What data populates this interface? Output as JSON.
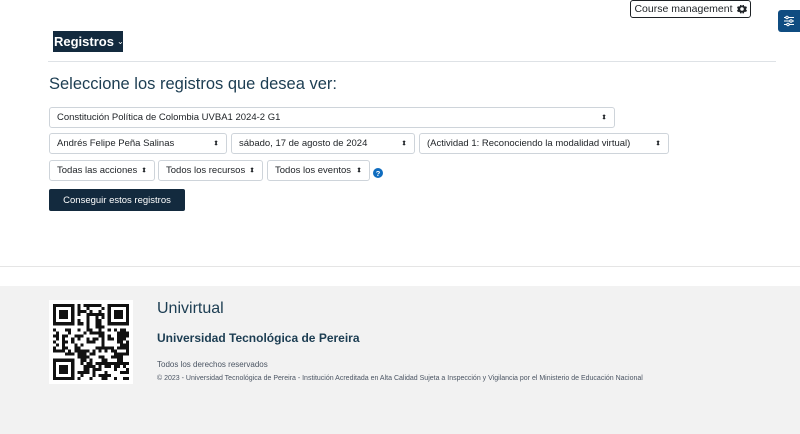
{
  "header": {
    "course_management_label": "Course management",
    "registros_label": "Registros"
  },
  "main": {
    "heading": "Seleccione los registros que desea ver:",
    "filters": {
      "course": "Constitución Política de Colombia UVBA1 2024-2 G1",
      "user": "Andrés Felipe Peña Salinas",
      "date": "sábado, 17 de agosto de 2024",
      "activity": "(Actividad 1: Reconociendo la modalidad virtual)",
      "actions": "Todas las acciones",
      "resources": "Todos los recursos",
      "events": "Todos los eventos"
    },
    "help_glyph": "?",
    "submit_label": "Conseguir estos registros"
  },
  "footer": {
    "title": "Univirtual",
    "subtitle": "Universidad Tecnológica de Pereira",
    "rights": "Todos los derechos reservados",
    "copyright": "© 2023 - Universidad Tecnológica de Pereira - Institución Acreditada en Alta Calidad Sujeta a Inspección y Vigilancia por el Ministerio de Educación Nacional"
  },
  "icons": {
    "settings": "gear-icon",
    "drawer": "sliders-icon",
    "dropdown": "caret-updown-icon",
    "help": "question-circle-icon",
    "qr": "qr-code-icon"
  },
  "colors": {
    "primary_dark": "#132a3e",
    "heading": "#1c3d52",
    "drawer": "#0f4c81",
    "help": "#0f6cbf",
    "footer_bg": "#f2f2f2"
  }
}
